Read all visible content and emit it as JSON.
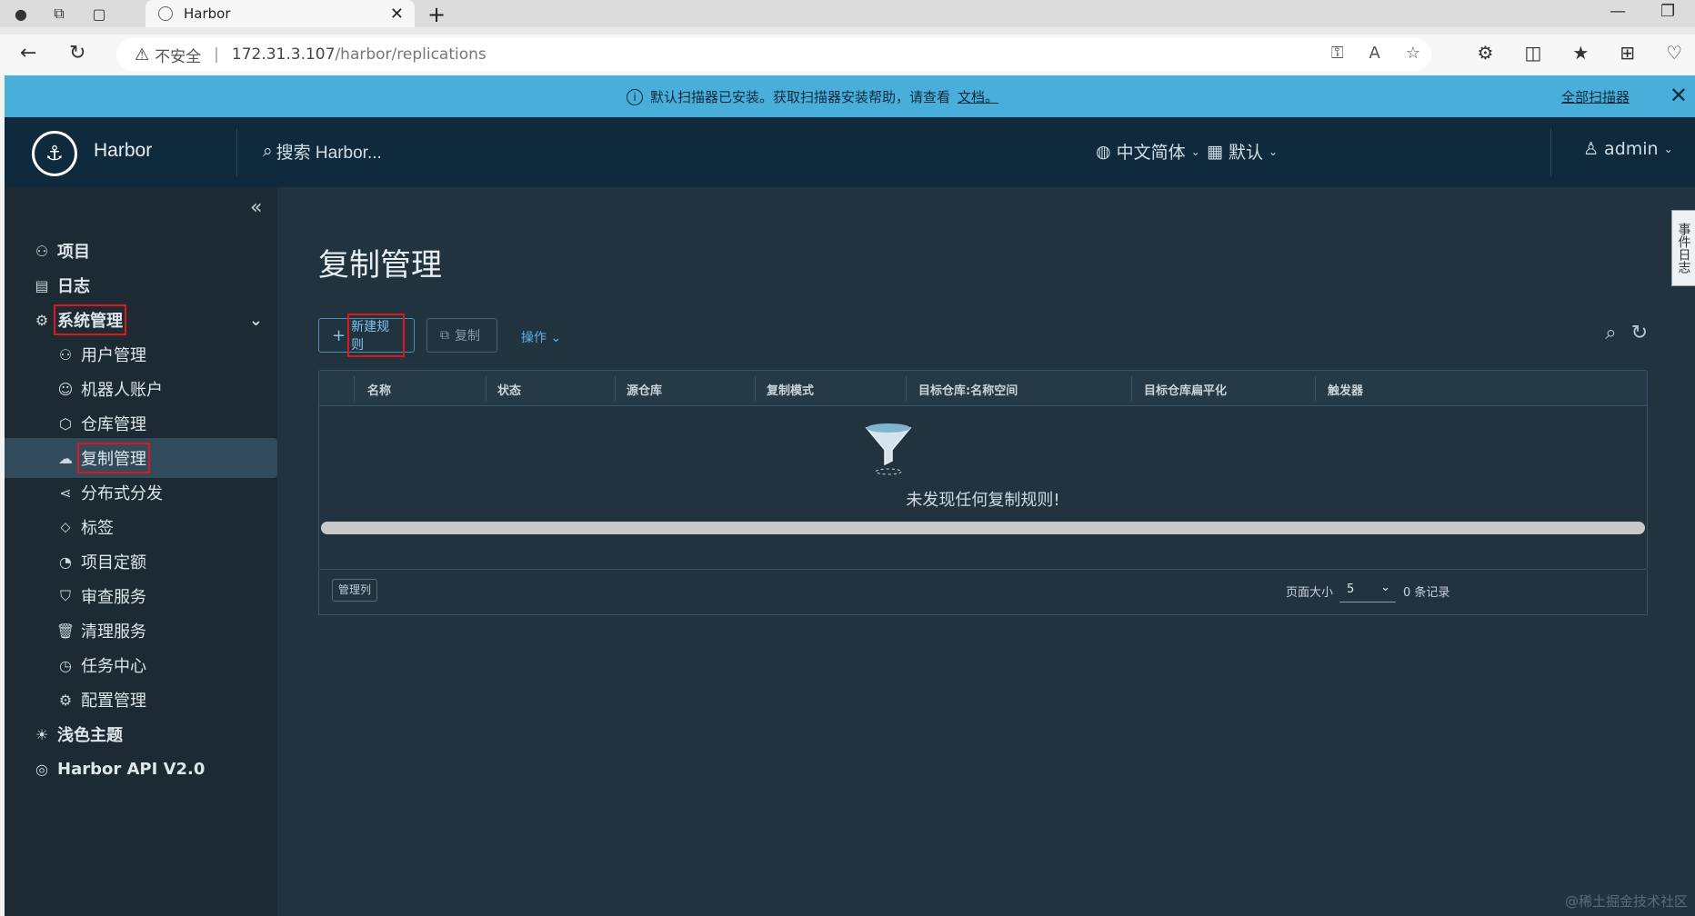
{
  "browser": {
    "tab_title": "Harbor",
    "insecure_label": "不安全",
    "url_host": "172.31.3.107",
    "url_path": "/harbor/replications"
  },
  "banner": {
    "message": "默认扫描器已安装。获取扫描器安装帮助，请查看",
    "link": "文档。",
    "all_scanners": "全部扫描器"
  },
  "header": {
    "brand": "Harbor",
    "search_placeholder": "搜索 Harbor...",
    "language": "中文简体",
    "theme": "默认",
    "user": "admin"
  },
  "event_log": "事件日志",
  "sidebar": {
    "items": [
      {
        "label": "项目",
        "icon": "projects-icon"
      },
      {
        "label": "日志",
        "icon": "logs-icon"
      },
      {
        "label": "系统管理",
        "icon": "admin-icon"
      },
      {
        "label": "用户管理",
        "icon": "users-icon"
      },
      {
        "label": "机器人账户",
        "icon": "robot-icon"
      },
      {
        "label": "仓库管理",
        "icon": "registry-icon"
      },
      {
        "label": "复制管理",
        "icon": "replication-icon"
      },
      {
        "label": "分布式分发",
        "icon": "distribution-icon"
      },
      {
        "label": "标签",
        "icon": "tag-icon"
      },
      {
        "label": "项目定额",
        "icon": "quota-icon"
      },
      {
        "label": "审查服务",
        "icon": "shield-icon"
      },
      {
        "label": "清理服务",
        "icon": "trash-icon"
      },
      {
        "label": "任务中心",
        "icon": "dashboard-icon"
      },
      {
        "label": "配置管理",
        "icon": "gear-icon"
      },
      {
        "label": "浅色主题",
        "icon": "sun-icon"
      },
      {
        "label": "Harbor API V2.0",
        "icon": "api-icon"
      }
    ]
  },
  "main": {
    "title": "复制管理",
    "new_rule": "新建规则",
    "copy": "复制",
    "actions": "操作",
    "columns": [
      "名称",
      "状态",
      "源仓库",
      "复制模式",
      "目标仓库:名称空间",
      "目标仓库扁平化",
      "触发器"
    ],
    "empty_text": "未发现任何复制规则!",
    "manage_columns": "管理列",
    "page_size_label": "页面大小",
    "page_size": "5",
    "records": "0 条记录"
  },
  "watermark": "@稀土掘金技术社区"
}
